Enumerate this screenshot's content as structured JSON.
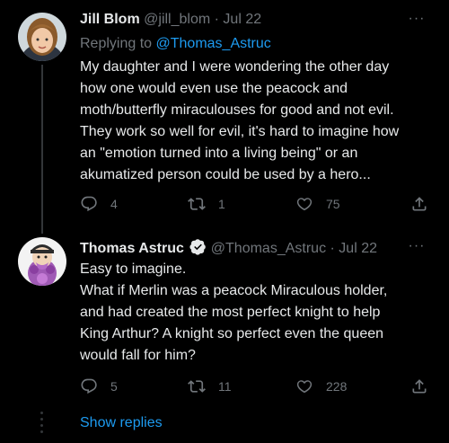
{
  "tweets": [
    {
      "name": "Jill Blom",
      "handle": "@jill_blom",
      "sep": "·",
      "date": "Jul 22",
      "replying_label": "Replying to ",
      "replying_to": "@Thomas_Astruc",
      "lines": [
        "My daughter and I were wondering the other day",
        "how one would even use the peacock and",
        "moth/butterfly miraculouses for good and not evil.",
        "They work so well for evil, it's hard to imagine how",
        "an \"emotion turned into a living being\" or an",
        "akumatized person could be used by a hero..."
      ],
      "replies": "4",
      "retweets": "1",
      "likes": "75"
    },
    {
      "name": "Thomas Astruc",
      "handle": "@Thomas_Astruc",
      "sep": "·",
      "date": "Jul 22",
      "lines": [
        "Easy to imagine.",
        "What if Merlin was a peacock Miraculous holder,",
        "and had created the most perfect knight to help",
        "King Arthur? A knight so perfect even the queen",
        "would fall for him?"
      ],
      "replies": "5",
      "retweets": "11",
      "likes": "228"
    }
  ],
  "more_glyph": "···",
  "show_replies": "Show replies",
  "colors": {
    "background": "#000000",
    "text": "#e7e9ea",
    "muted": "#71767b",
    "link": "#1d9bf0",
    "verified": "#1d9bf0"
  },
  "icons": [
    "reply-icon",
    "retweet-icon",
    "like-icon",
    "share-icon",
    "verified-badge-icon",
    "more-icon"
  ]
}
